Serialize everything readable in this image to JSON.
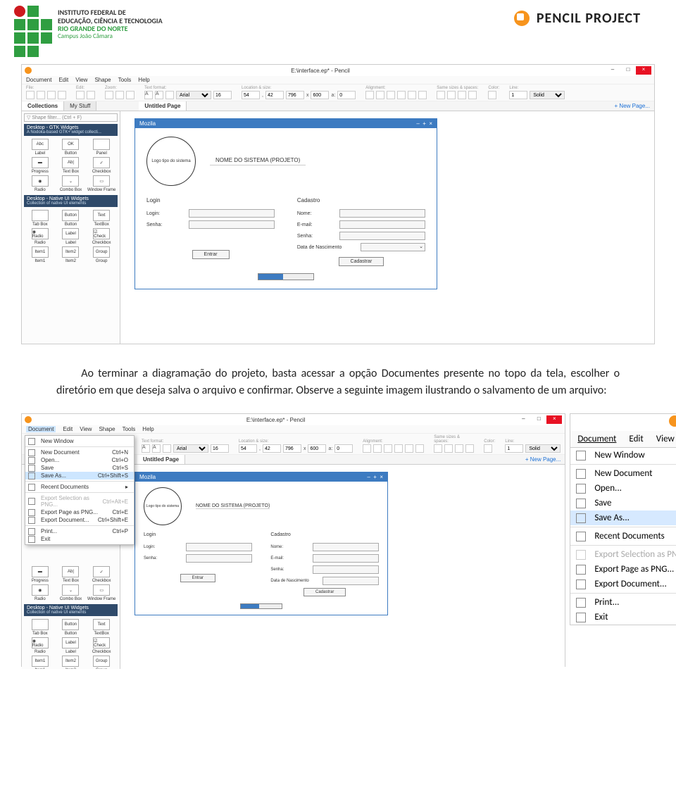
{
  "header": {
    "institute_line1": "INSTITUTO FEDERAL DE",
    "institute_line2": "EDUCAÇÃO, CIÊNCIA E TECNOLOGIA",
    "institute_line3": "RIO GRANDE DO NORTE",
    "institute_line4": "Campus João Câmara",
    "pencil": "PENCIL PROJECT"
  },
  "app": {
    "title": "E:\\interface.ep* - Pencil",
    "menu": [
      "Document",
      "Edit",
      "View",
      "Shape",
      "Tools",
      "Help"
    ],
    "toolbar_labels": {
      "file": "File:",
      "edit": "Edit:",
      "zoom": "Zoom:",
      "tf": "Text format:",
      "ls": "Location & size:",
      "al": "Alignment:",
      "ss": "Same sizes & spaces:",
      "col": "Color:",
      "line": "Line:"
    },
    "font": "Arial",
    "fsize": "16",
    "x": "54",
    "y": "42",
    "w": "796",
    "h": "600",
    "r": "0",
    "linew": "1",
    "linestyle": "Solid",
    "tabs": {
      "c": "Collections",
      "ms": "My Stuff",
      "page": "Untitled Page",
      "new": "+  New Page..."
    },
    "filter": "▽ Shape filter... (Ctrl + F)",
    "coll1": {
      "title": "Desktop - GTK Widgets",
      "sub": "A Nodoka-based GTK+ widget collecti..."
    },
    "coll2": {
      "title": "Desktop - Native UI Widgets",
      "sub": "Collection of native UI elements"
    },
    "widgets1": [
      {
        "ic": "Abc",
        "l": "Label"
      },
      {
        "ic": "OK",
        "l": "Button"
      },
      {
        "ic": "",
        "l": "Panel"
      },
      {
        "ic": "▬",
        "l": "Progress"
      },
      {
        "ic": "Ab|",
        "l": "Text Box"
      },
      {
        "ic": "✓",
        "l": "Checkbox"
      },
      {
        "ic": "◉",
        "l": "Radio"
      },
      {
        "ic": "⌄",
        "l": "Combo Box"
      },
      {
        "ic": "▭",
        "l": "Window Frame"
      }
    ],
    "widgets2": [
      {
        "ic": "",
        "l": "Tab Box"
      },
      {
        "ic": "Button",
        "l": "Button"
      },
      {
        "ic": "Text",
        "l": "TextBox"
      },
      {
        "ic": "◉ Radio",
        "l": "Radio"
      },
      {
        "ic": "Label",
        "l": "Label"
      },
      {
        "ic": "☑ Check",
        "l": "Checkbox"
      },
      {
        "ic": "Item1",
        "l": "Item1"
      },
      {
        "ic": "Item2",
        "l": "Item2"
      },
      {
        "ic": "Group",
        "l": "Group"
      }
    ]
  },
  "mockup": {
    "win": "Mozila",
    "ring": "Logo tipo do sistema",
    "sys": "NOME DO SISTEMA (PROJETO)",
    "login_h": "Login",
    "cad_h": "Cadastro",
    "login_l": "Login:",
    "senha_l": "Senha:",
    "nome": "Nome:",
    "email": "E-mail:",
    "senha2": "Senha:",
    "dn": "Data de Nascimento",
    "entrar": "Entrar",
    "cadastrar": "Cadastrar"
  },
  "paragraph": "Ao terminar a diagramação do projeto, basta acessar a opção Documentes presente no topo da tela, escolher o diretório em que deseja salva o arquivo e confirmar. Observe a seguinte imagem ilustrando o salvamento de um arquivo:",
  "docmenu": [
    {
      "l": "New Window",
      "s": ""
    },
    {
      "l": "New Document",
      "s": "Ctrl+N"
    },
    {
      "l": "Open...",
      "s": "Ctrl+O"
    },
    {
      "l": "Save",
      "s": "Ctrl+S"
    },
    {
      "l": "Save As...",
      "s": "Ctrl+Shift+S",
      "hl": true
    },
    {
      "l": "Recent Documents",
      "s": "▸"
    },
    {
      "l": "Export Selection as PNG...",
      "s": "Ctrl+Alt+E",
      "dis": true
    },
    {
      "l": "Export Page as PNG...",
      "s": "Ctrl+E"
    },
    {
      "l": "Export Document...",
      "s": "Ctrl+Shift+E"
    },
    {
      "l": "Print...",
      "s": "Ctrl+P"
    },
    {
      "l": "Exit",
      "s": ""
    }
  ]
}
